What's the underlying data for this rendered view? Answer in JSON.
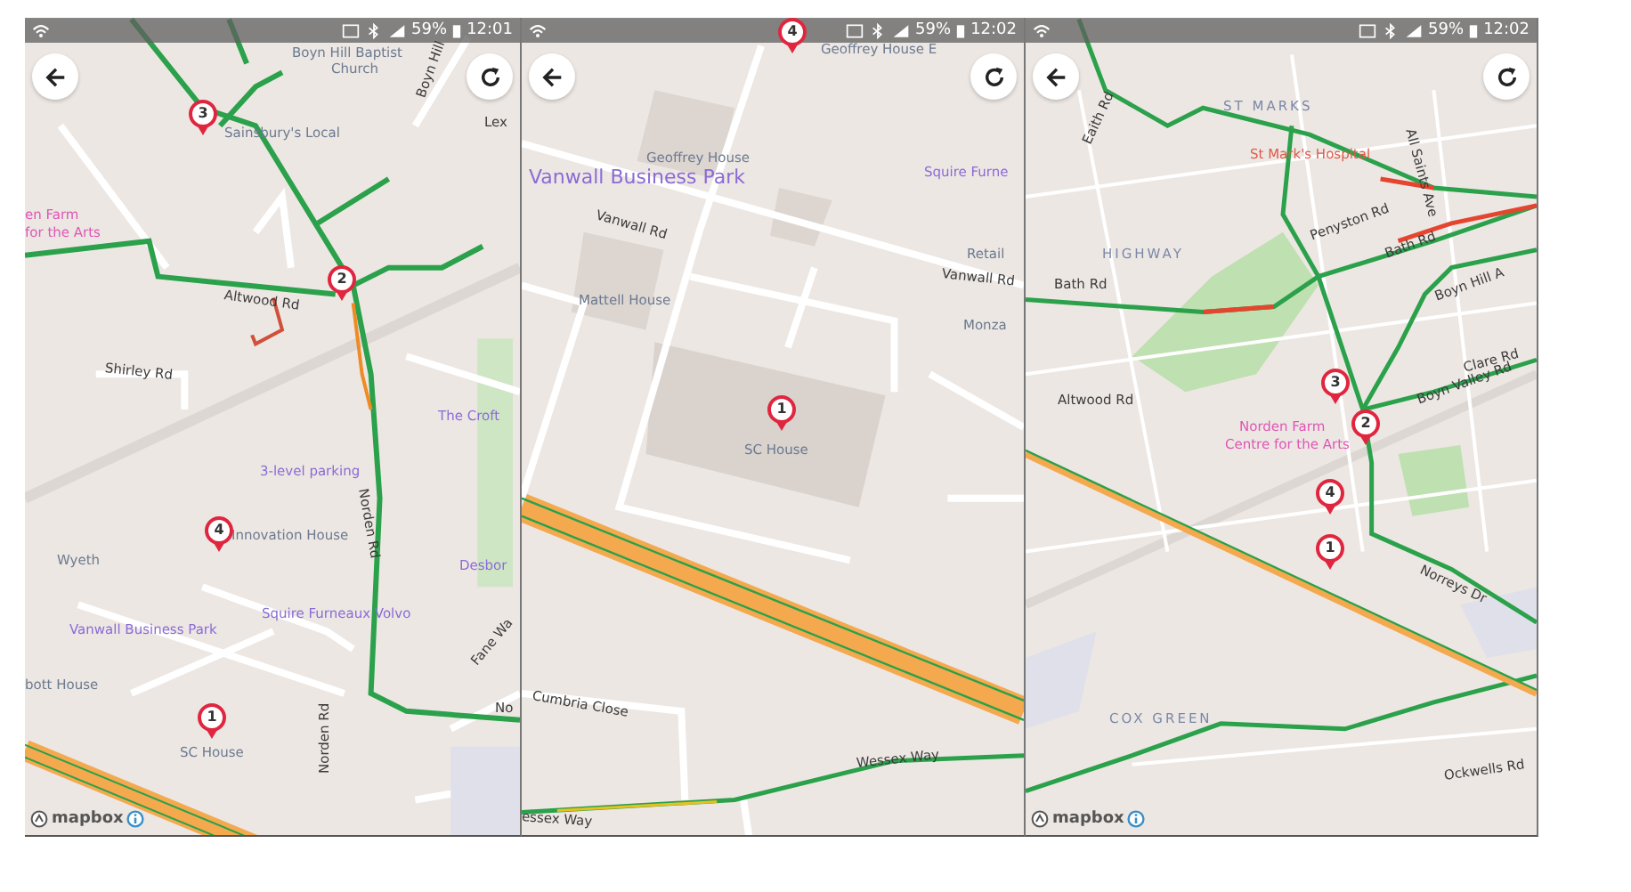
{
  "screens": [
    {
      "status_bar": {
        "battery": "59%",
        "time": "12:01"
      },
      "map_labels": [
        {
          "text": "Boyn Hill Baptist",
          "kind": "poi"
        },
        {
          "text": "Church",
          "kind": "poi"
        },
        {
          "text": "Sainsbury's Local",
          "kind": "poi"
        },
        {
          "text": "Boyn Hill",
          "kind": "street"
        },
        {
          "text": "Lex",
          "kind": "street"
        },
        {
          "text": "en Farm",
          "kind": "arts"
        },
        {
          "text": "for the Arts",
          "kind": "arts"
        },
        {
          "text": "Altwood Rd",
          "kind": "street"
        },
        {
          "text": "Shirley Rd",
          "kind": "street"
        },
        {
          "text": "The Croft",
          "kind": "venue"
        },
        {
          "text": "3-level parking",
          "kind": "venue"
        },
        {
          "text": "Norden Rd",
          "kind": "street"
        },
        {
          "text": "Innovation House",
          "kind": "poi"
        },
        {
          "text": "Wyeth",
          "kind": "poi"
        },
        {
          "text": "Desbor",
          "kind": "venue"
        },
        {
          "text": "Squire Furneaux Volvo",
          "kind": "venue"
        },
        {
          "text": "Vanwall Business Park",
          "kind": "venue"
        },
        {
          "text": "Fane Wa",
          "kind": "street"
        },
        {
          "text": "bott House",
          "kind": "poi"
        },
        {
          "text": "SC House",
          "kind": "poi"
        },
        {
          "text": "No",
          "kind": "street"
        },
        {
          "text": "Norden Rd",
          "kind": "street"
        }
      ],
      "markers": [
        {
          "number": "3"
        },
        {
          "number": "2"
        },
        {
          "number": "4"
        },
        {
          "number": "1"
        }
      ],
      "attribution": "mapbox"
    },
    {
      "status_bar": {
        "battery": "59%",
        "time": "12:02"
      },
      "map_labels": [
        {
          "text": "Geoffrey House E",
          "kind": "poi"
        },
        {
          "text": "Geoffrey House",
          "kind": "poi"
        },
        {
          "text": "Vanwall Business Park",
          "kind": "park"
        },
        {
          "text": "Vanwall Rd",
          "kind": "street"
        },
        {
          "text": "Squire Furne",
          "kind": "venue"
        },
        {
          "text": "Retail",
          "kind": "poi"
        },
        {
          "text": "Vanwall Rd",
          "kind": "street"
        },
        {
          "text": "Mattell House",
          "kind": "poi"
        },
        {
          "text": "Monza",
          "kind": "poi"
        },
        {
          "text": "SC House",
          "kind": "poi"
        },
        {
          "text": "Cumbria Close",
          "kind": "street"
        },
        {
          "text": "Wessex Way",
          "kind": "street"
        },
        {
          "text": "essex Way",
          "kind": "street"
        }
      ],
      "markers": [
        {
          "number": "4"
        },
        {
          "number": "1"
        }
      ]
    },
    {
      "status_bar": {
        "battery": "59%",
        "time": "12:02"
      },
      "map_labels": [
        {
          "text": "Eaith Rd",
          "kind": "street"
        },
        {
          "text": "ST MARKS",
          "kind": "area"
        },
        {
          "text": "St Mark's Hospital",
          "kind": "hospital"
        },
        {
          "text": "All Saints Ave",
          "kind": "street"
        },
        {
          "text": "Penyston Rd",
          "kind": "street"
        },
        {
          "text": "HIGHWAY",
          "kind": "area"
        },
        {
          "text": "Bath Rd",
          "kind": "street"
        },
        {
          "text": "Bath Rd",
          "kind": "street"
        },
        {
          "text": "Boyn Hill A",
          "kind": "street"
        },
        {
          "text": "Clare Rd",
          "kind": "street"
        },
        {
          "text": "Boyn Valley Rd",
          "kind": "street"
        },
        {
          "text": "Altwood Rd",
          "kind": "street"
        },
        {
          "text": "Norden Farm",
          "kind": "arts"
        },
        {
          "text": "Centre for the Arts",
          "kind": "arts"
        },
        {
          "text": "Norreys Dr",
          "kind": "street"
        },
        {
          "text": "COX GREEN",
          "kind": "area"
        },
        {
          "text": "Ockwells Rd",
          "kind": "street"
        }
      ],
      "markers": [
        {
          "number": "3"
        },
        {
          "number": "2"
        },
        {
          "number": "4"
        },
        {
          "number": "1"
        }
      ],
      "attribution": "mapbox"
    }
  ]
}
